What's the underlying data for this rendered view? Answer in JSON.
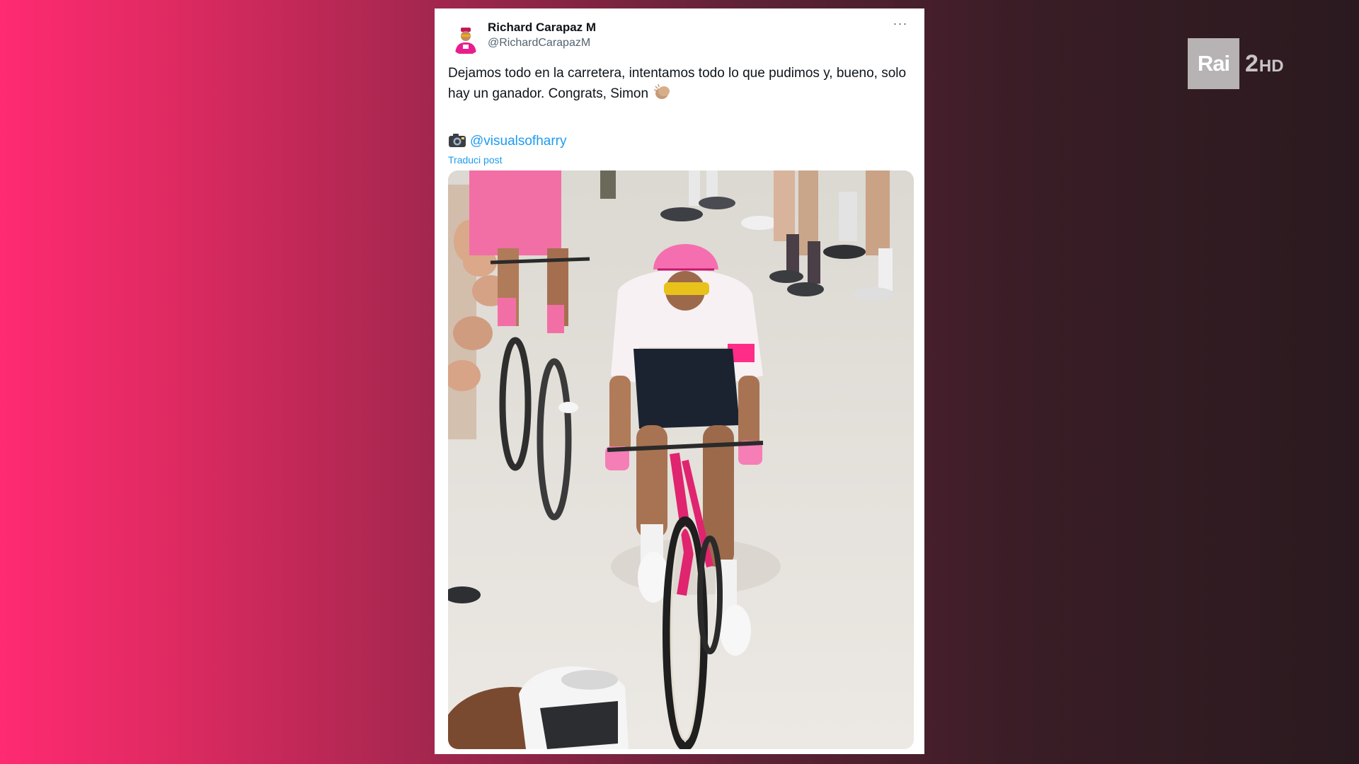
{
  "tweet": {
    "display_name": "Richard Carapaz M",
    "handle": "@RichardCarapazM",
    "more_label": "···",
    "text": "Dejamos todo en la carretera, intentamos todo lo que pudimos y, bueno, solo hay un ganador. Congrats, Simon",
    "text_emoji": "clapping-hands-icon",
    "credit_emoji": "camera-with-flash-icon",
    "credit_mention": "@visualsofharry",
    "translate_label": "Traduci post",
    "photo_subject": "cyclist-photo"
  },
  "channel_logo": {
    "brand": "Rai",
    "number": "2",
    "suffix": "HD"
  },
  "colors": {
    "link": "#1d9bf0",
    "text": "#0f1419",
    "secondary_text": "#536471",
    "bg_left": "#ff2a72",
    "bg_right": "#2a1a1f"
  }
}
